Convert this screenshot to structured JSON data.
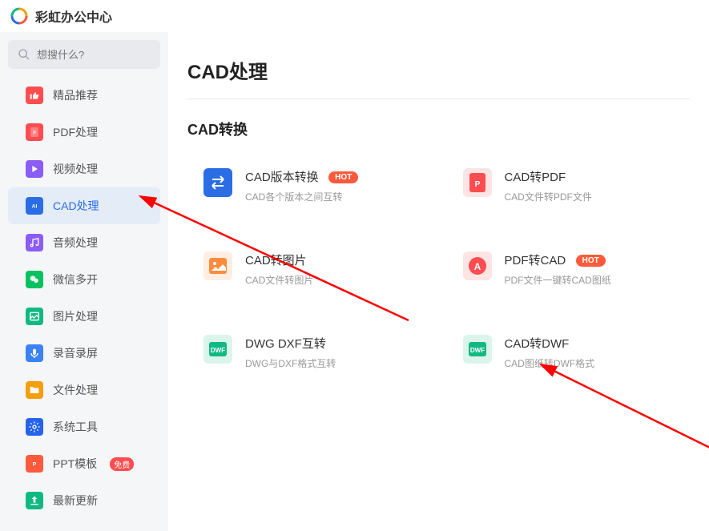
{
  "app_title": "彩虹办公中心",
  "search": {
    "placeholder": "想搜什么?"
  },
  "sidebar": [
    {
      "label": "精品推荐",
      "color": "#ff4d4f",
      "active": false,
      "badge": null,
      "icon": "thumb"
    },
    {
      "label": "PDF处理",
      "color": "#ff4d4f",
      "active": false,
      "badge": null,
      "icon": "pdf"
    },
    {
      "label": "视频处理",
      "color": "#8b5cf6",
      "active": false,
      "badge": null,
      "icon": "play"
    },
    {
      "label": "CAD处理",
      "color": "#2b6de5",
      "active": true,
      "badge": null,
      "icon": "cad"
    },
    {
      "label": "音频处理",
      "color": "#8b5cf6",
      "active": false,
      "badge": null,
      "icon": "music"
    },
    {
      "label": "微信多开",
      "color": "#07c160",
      "active": false,
      "badge": null,
      "icon": "wechat"
    },
    {
      "label": "图片处理",
      "color": "#10b981",
      "active": false,
      "badge": null,
      "icon": "image"
    },
    {
      "label": "录音录屏",
      "color": "#3b82f6",
      "active": false,
      "badge": null,
      "icon": "mic"
    },
    {
      "label": "文件处理",
      "color": "#f59e0b",
      "active": false,
      "badge": null,
      "icon": "folder"
    },
    {
      "label": "系统工具",
      "color": "#2563eb",
      "active": false,
      "badge": null,
      "icon": "gear"
    },
    {
      "label": "PPT模板",
      "color": "#ff5a3c",
      "active": false,
      "badge": "免费",
      "icon": "ppt"
    },
    {
      "label": "最新更新",
      "color": "#10b981",
      "active": false,
      "badge": null,
      "icon": "upload"
    }
  ],
  "page_title": "CAD处理",
  "section_title": "CAD转换",
  "features": [
    {
      "title": "CAD版本转换",
      "desc": "CAD各个版本之间互转",
      "badge": "HOT",
      "color": "#2b6de5",
      "icon": "swap"
    },
    {
      "title": "CAD转PDF",
      "desc": "CAD文件转PDF文件",
      "badge": null,
      "color": "#ff4d4f",
      "icon": "pdf"
    },
    {
      "title": "CAD转图片",
      "desc": "CAD文件转图片",
      "badge": null,
      "color": "#ff8c3c",
      "icon": "img"
    },
    {
      "title": "PDF转CAD",
      "desc": "PDF文件一键转CAD图纸",
      "badge": "HOT",
      "color": "#ff4d4f",
      "icon": "a"
    },
    {
      "title": "DWG DXF互转",
      "desc": "DWG与DXF格式互转",
      "badge": null,
      "color": "#10b981",
      "icon": "dwf"
    },
    {
      "title": "CAD转DWF",
      "desc": "CAD图纸转DWF格式",
      "badge": null,
      "color": "#10b981",
      "icon": "dwf"
    }
  ],
  "badge_free": "免费"
}
